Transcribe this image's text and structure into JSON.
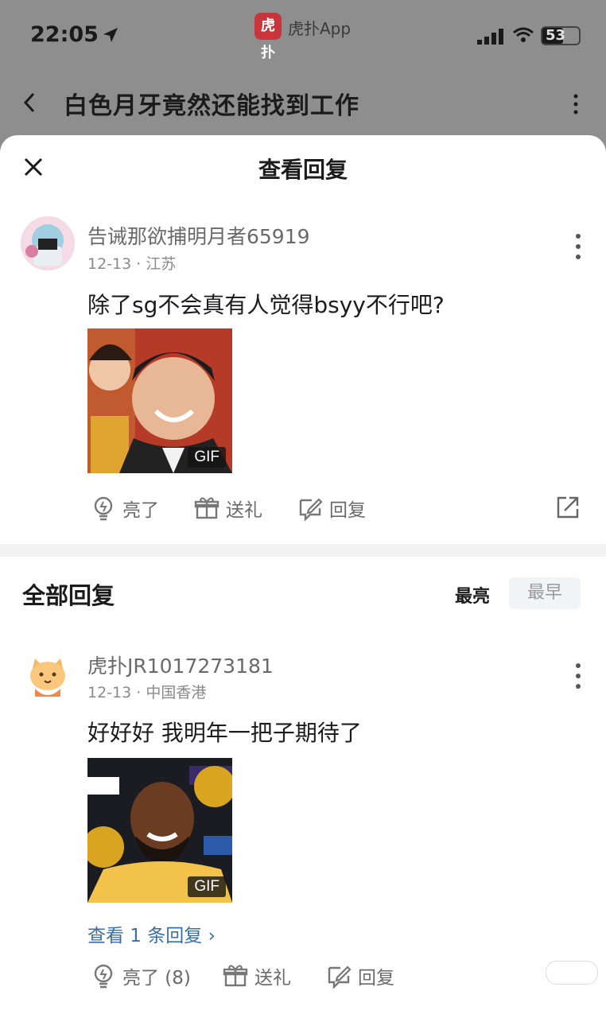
{
  "status_bar": {
    "time": "22:05",
    "battery": "53"
  },
  "app": {
    "logo_text": "虎扑",
    "name": "虎扑App"
  },
  "page": {
    "title": "白色月牙竟然还能找到工作"
  },
  "sheet": {
    "title": "查看回复"
  },
  "main_comment": {
    "username": "告诫那欲捕明月者65919",
    "date": "12-13",
    "location": "江苏",
    "meta": "12-13 · 江苏",
    "text": "除了sg不会真有人觉得bsyy不行吧?",
    "media_badge": "GIF",
    "actions": {
      "light": "亮了",
      "gift": "送礼",
      "reply": "回复"
    }
  },
  "replies_section": {
    "title": "全部回复",
    "sort_options": [
      "最亮",
      "最早"
    ],
    "sort_selected": "最亮"
  },
  "replies": [
    {
      "username": "虎扑JR1017273181",
      "meta": "12-13 · 中国香港",
      "text": "好好好 我明年一把子期待了",
      "media_badge": "GIF",
      "view_replies": "查看 1 条回复 ›",
      "actions": {
        "light": "亮了 (8)",
        "gift": "送礼",
        "reply": "回复"
      }
    }
  ],
  "colors": {
    "brand": "#c8353b",
    "link": "#3a6ea8",
    "overlay": "#8e8e8e"
  }
}
